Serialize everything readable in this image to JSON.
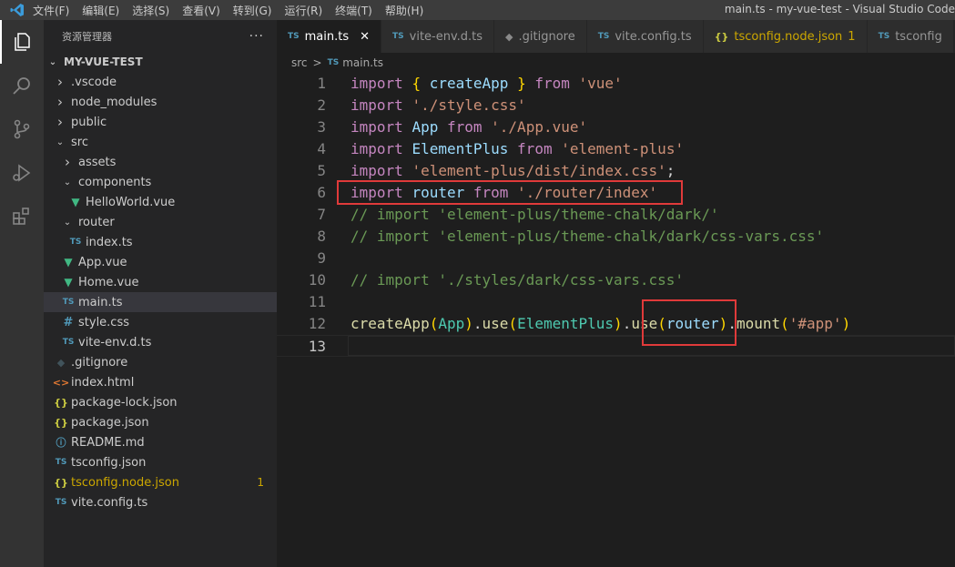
{
  "titlebar": {
    "menus": [
      "文件(F)",
      "编辑(E)",
      "选择(S)",
      "查看(V)",
      "转到(G)",
      "运行(R)",
      "终端(T)",
      "帮助(H)"
    ],
    "window_title": "main.ts - my-vue-test - Visual Studio Code"
  },
  "activitybar": {
    "icons": [
      "files-icon",
      "search-icon",
      "source-control-icon",
      "run-debug-icon",
      "extensions-icon"
    ]
  },
  "sidebar": {
    "title": "资源管理器",
    "more": "···",
    "project": "MY-VUE-TEST",
    "tree": [
      {
        "label": ".vscode",
        "type": "folder",
        "expanded": false,
        "depth": 1
      },
      {
        "label": "node_modules",
        "type": "folder",
        "expanded": false,
        "depth": 1
      },
      {
        "label": "public",
        "type": "folder",
        "expanded": false,
        "depth": 1
      },
      {
        "label": "src",
        "type": "folder",
        "expanded": true,
        "depth": 1
      },
      {
        "label": "assets",
        "type": "folder",
        "expanded": false,
        "depth": 2
      },
      {
        "label": "components",
        "type": "folder",
        "expanded": true,
        "depth": 2
      },
      {
        "label": "HelloWorld.vue",
        "type": "vue",
        "depth": 3
      },
      {
        "label": "router",
        "type": "folder",
        "expanded": true,
        "depth": 2
      },
      {
        "label": "index.ts",
        "type": "ts",
        "depth": 3
      },
      {
        "label": "App.vue",
        "type": "vue",
        "depth": 2
      },
      {
        "label": "Home.vue",
        "type": "vue",
        "depth": 2
      },
      {
        "label": "main.ts",
        "type": "ts",
        "depth": 2,
        "selected": true
      },
      {
        "label": "style.css",
        "type": "css",
        "depth": 2
      },
      {
        "label": "vite-env.d.ts",
        "type": "ts",
        "depth": 2
      },
      {
        "label": ".gitignore",
        "type": "git",
        "depth": 1
      },
      {
        "label": "index.html",
        "type": "html",
        "depth": 1
      },
      {
        "label": "package-lock.json",
        "type": "json",
        "depth": 1
      },
      {
        "label": "package.json",
        "type": "json",
        "depth": 1
      },
      {
        "label": "README.md",
        "type": "info",
        "depth": 1
      },
      {
        "label": "tsconfig.json",
        "type": "tsconfig",
        "depth": 1
      },
      {
        "label": "tsconfig.node.json",
        "type": "json",
        "depth": 1,
        "warning": "1"
      },
      {
        "label": "vite.config.ts",
        "type": "ts",
        "depth": 1
      }
    ]
  },
  "tabs": [
    {
      "label": "main.ts",
      "icon": "TS",
      "active": true,
      "close": "✕"
    },
    {
      "label": "vite-env.d.ts",
      "icon": "TS"
    },
    {
      "label": ".gitignore",
      "icon": "◆"
    },
    {
      "label": "vite.config.ts",
      "icon": "TS"
    },
    {
      "label": "tsconfig.node.json",
      "icon": "{}",
      "badge": "1"
    },
    {
      "label": "tsconfig",
      "icon": "TS"
    }
  ],
  "breadcrumb": {
    "folder": "src",
    "separator": ">",
    "file_icon": "TS",
    "file": "main.ts"
  },
  "editor": {
    "current_line": 13,
    "lines": [
      [
        [
          "kw",
          "import"
        ],
        [
          "pl",
          " "
        ],
        [
          "br",
          "{"
        ],
        [
          "pl",
          " "
        ],
        [
          "var",
          "createApp"
        ],
        [
          "pl",
          " "
        ],
        [
          "br",
          "}"
        ],
        [
          "pl",
          " "
        ],
        [
          "kw",
          "from"
        ],
        [
          "pl",
          " "
        ],
        [
          "str",
          "'vue'"
        ]
      ],
      [
        [
          "kw",
          "import"
        ],
        [
          "pl",
          " "
        ],
        [
          "str",
          "'./style.css'"
        ]
      ],
      [
        [
          "kw",
          "import"
        ],
        [
          "pl",
          " "
        ],
        [
          "var",
          "App"
        ],
        [
          "pl",
          " "
        ],
        [
          "kw",
          "from"
        ],
        [
          "pl",
          " "
        ],
        [
          "str",
          "'./App.vue'"
        ]
      ],
      [
        [
          "kw",
          "import"
        ],
        [
          "pl",
          " "
        ],
        [
          "var",
          "ElementPlus"
        ],
        [
          "pl",
          " "
        ],
        [
          "kw",
          "from"
        ],
        [
          "pl",
          " "
        ],
        [
          "str",
          "'element-plus'"
        ]
      ],
      [
        [
          "kw",
          "import"
        ],
        [
          "pl",
          " "
        ],
        [
          "str",
          "'element-plus/dist/index.css'"
        ],
        [
          "pl",
          ";"
        ]
      ],
      [
        [
          "kw",
          "import"
        ],
        [
          "pl",
          " "
        ],
        [
          "var",
          "router"
        ],
        [
          "pl",
          " "
        ],
        [
          "kw",
          "from"
        ],
        [
          "pl",
          " "
        ],
        [
          "str",
          "'./router/index'"
        ]
      ],
      [
        [
          "cm",
          "// import 'element-plus/theme-chalk/dark/'"
        ]
      ],
      [
        [
          "cm",
          "// import 'element-plus/theme-chalk/dark/css-vars.css'"
        ]
      ],
      [],
      [
        [
          "cm",
          "// import './styles/dark/css-vars.css'"
        ]
      ],
      [],
      [
        [
          "fn",
          "createApp"
        ],
        [
          "br",
          "("
        ],
        [
          "cls",
          "App"
        ],
        [
          "br",
          ")"
        ],
        [
          "pl",
          "."
        ],
        [
          "fn",
          "use"
        ],
        [
          "br",
          "("
        ],
        [
          "cls",
          "ElementPlus"
        ],
        [
          "br",
          ")"
        ],
        [
          "pl",
          "."
        ],
        [
          "fn",
          "use"
        ],
        [
          "br",
          "("
        ],
        [
          "var",
          "router"
        ],
        [
          "br",
          ")"
        ],
        [
          "pl",
          "."
        ],
        [
          "fn",
          "mount"
        ],
        [
          "br",
          "("
        ],
        [
          "str",
          "'#app'"
        ],
        [
          "br",
          ")"
        ]
      ],
      []
    ]
  },
  "colors": {
    "annotation_box": "#e03a3a",
    "warning": "#cca700"
  }
}
